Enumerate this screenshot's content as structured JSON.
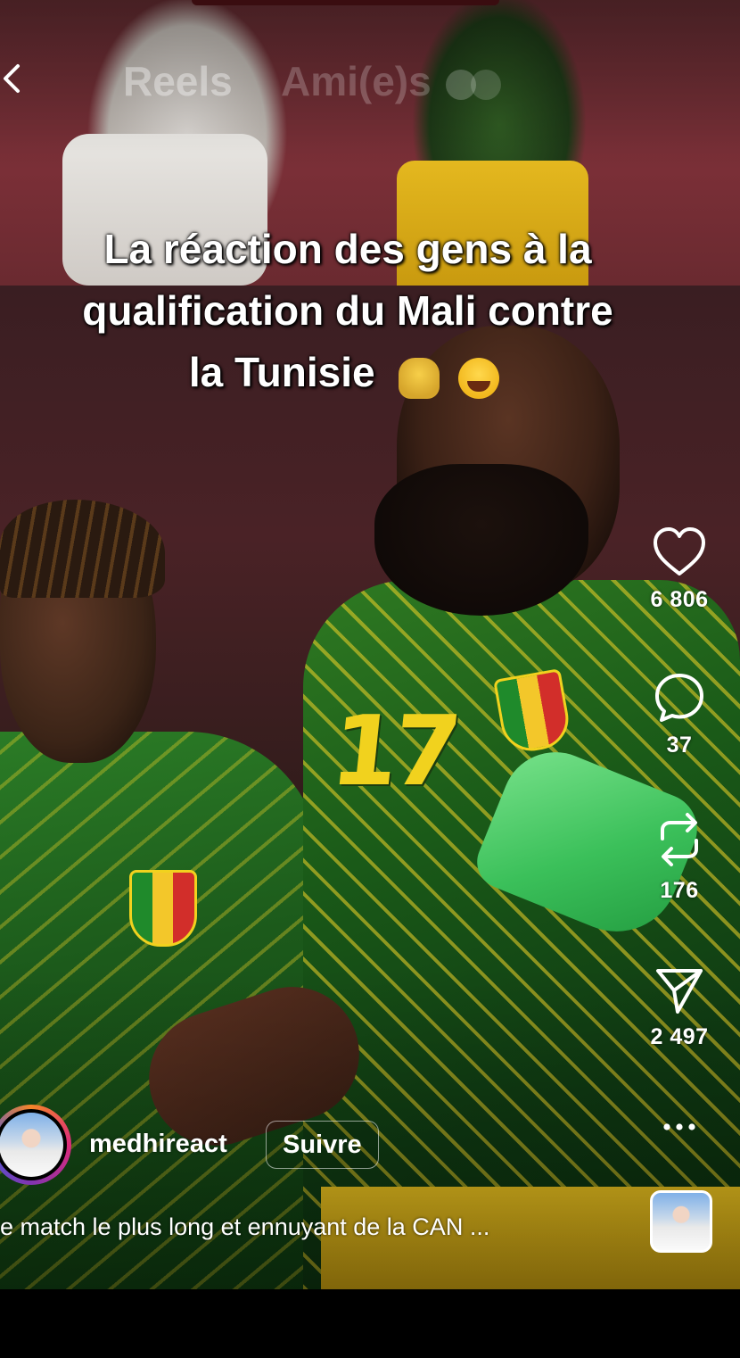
{
  "nav": {
    "tab_reels": "Reels",
    "tab_friends": "Ami(e)s"
  },
  "video": {
    "overlay_line1": "La réaction des gens à la",
    "overlay_line2": "qualification du Mali contre",
    "overlay_line3": "la Tunisie",
    "overlay_emojis": [
      "clapping-hands",
      "face-with-tears-of-joy"
    ],
    "jersey_number": "17"
  },
  "actions": {
    "likes": "6 806",
    "comments": "37",
    "reposts": "176",
    "shares": "2 497"
  },
  "author": {
    "username": "medhireact",
    "follow_label": "Suivre"
  },
  "description": "e match le plus long et ennuyant de la CAN ...",
  "icons": {
    "like": "heart-icon",
    "comment": "comment-bubble-icon",
    "repost": "repost-icon",
    "share": "paper-plane-icon",
    "more": "more-dots-icon",
    "back": "chevron-left-icon"
  },
  "colors": {
    "text": "#ffffff",
    "jersey_green": "#1c5a1b",
    "jersey_yellow": "#f1d21e"
  }
}
